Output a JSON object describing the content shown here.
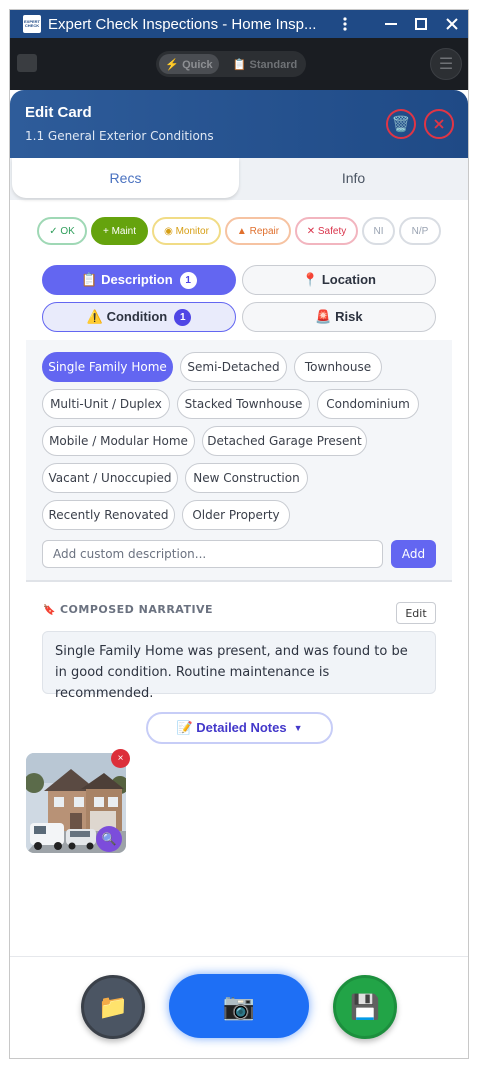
{
  "window": {
    "title": "Expert Check Inspections - Home Insp...",
    "logo_text": "EXPERT CHECK",
    "icons": {
      "more": "kebab-icon",
      "maximize": "square-icon",
      "close": "x-icon"
    }
  },
  "background_app": {
    "mode_quick": "⚡ Quick",
    "mode_standard": "📋 Standard"
  },
  "modal": {
    "title": "Edit Card",
    "subtitle": "1.1 General Exterior Conditions",
    "accent_color": "#1f4a86"
  },
  "tabs": [
    {
      "label": "Recs",
      "active": true
    },
    {
      "label": "Info",
      "active": false
    }
  ],
  "status_chips": [
    {
      "label": "✓ OK",
      "color": "#2f9e5b"
    },
    {
      "label": "+ Maint",
      "color": "#65a30d"
    },
    {
      "label": "◉ Monitor",
      "color": "#d69e14"
    },
    {
      "label": "▲ Repair",
      "color": "#e0702e"
    },
    {
      "label": "✕ Safety",
      "color": "#d9344b"
    },
    {
      "label": "NI",
      "color": "#9aa3b2"
    },
    {
      "label": "N/P",
      "color": "#9aa3b2"
    }
  ],
  "categories": {
    "description": {
      "label": "📋 Description",
      "count": "1"
    },
    "location": {
      "label": "📍 Location"
    },
    "condition": {
      "label": "⚠️ Condition",
      "count": "1"
    },
    "risk": {
      "label": "🚨 Risk"
    }
  },
  "options": [
    {
      "label": "Single Family Home",
      "selected": true
    },
    {
      "label": "Semi-Detached",
      "selected": false
    },
    {
      "label": "Townhouse",
      "selected": false
    },
    {
      "label": "Multi-Unit / Duplex",
      "selected": false
    },
    {
      "label": "Stacked Townhouse",
      "selected": false
    },
    {
      "label": "Condominium",
      "selected": false
    },
    {
      "label": "Mobile / Modular Home",
      "selected": false
    },
    {
      "label": "Detached Garage Present",
      "selected": false
    },
    {
      "label": "Vacant / Unoccupied",
      "selected": false
    },
    {
      "label": "New Construction",
      "selected": false
    },
    {
      "label": "Recently Renovated",
      "selected": false
    },
    {
      "label": "Older Property",
      "selected": false
    }
  ],
  "custom": {
    "placeholder": "Add custom description...",
    "add_label": "Add"
  },
  "narrative": {
    "label": "COMPOSED NARRATIVE",
    "edit_label": "Edit",
    "text": "Single Family Home was present, and was found to be in good condition. Routine maintenance is recommended."
  },
  "notes": {
    "label": "📝 Detailed Notes",
    "caret": "▼"
  },
  "photo": {
    "delete_icon": "×",
    "zoom_icon": "🔍"
  },
  "actions": {
    "folder": "📁",
    "camera": "📷",
    "save": "💾"
  }
}
